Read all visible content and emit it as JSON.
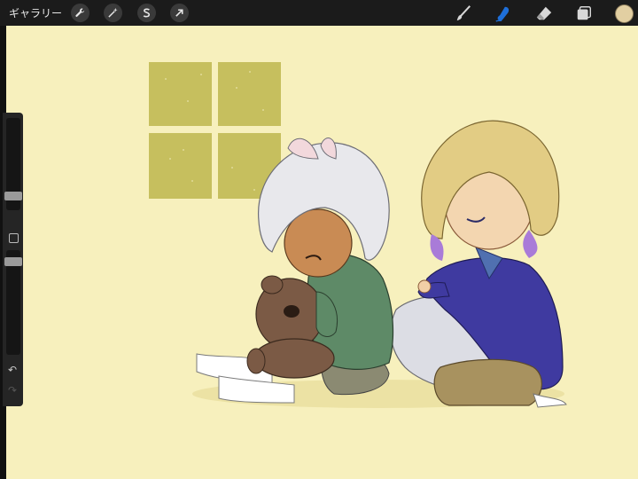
{
  "topbar": {
    "gallery_label": "ギャラリー",
    "left_tools": [
      {
        "icon": "wrench-icon"
      },
      {
        "icon": "magic-wand-icon"
      },
      {
        "icon": "selection-icon"
      },
      {
        "icon": "transform-arrow-icon"
      }
    ],
    "right_tools": [
      {
        "icon": "brush-icon",
        "active": false
      },
      {
        "icon": "smudge-icon",
        "active": true
      },
      {
        "icon": "eraser-icon",
        "active": false
      },
      {
        "icon": "layers-icon",
        "active": false
      }
    ],
    "current_color": "#e2cfa2"
  },
  "sidebar": {
    "size_slider_level": 0.27,
    "opacity_slider_level": 0.95,
    "undo_icon": "undo-icon",
    "redo_icon": "redo-icon"
  },
  "canvas": {
    "background": "#f7f0bd",
    "window_color": "#c6bf5e",
    "artwork": "illustration-two-children-with-teddy-bear"
  },
  "colors": {
    "accent_active": "#1e6fd9",
    "toolbar_bg": "#1b1b1b"
  }
}
